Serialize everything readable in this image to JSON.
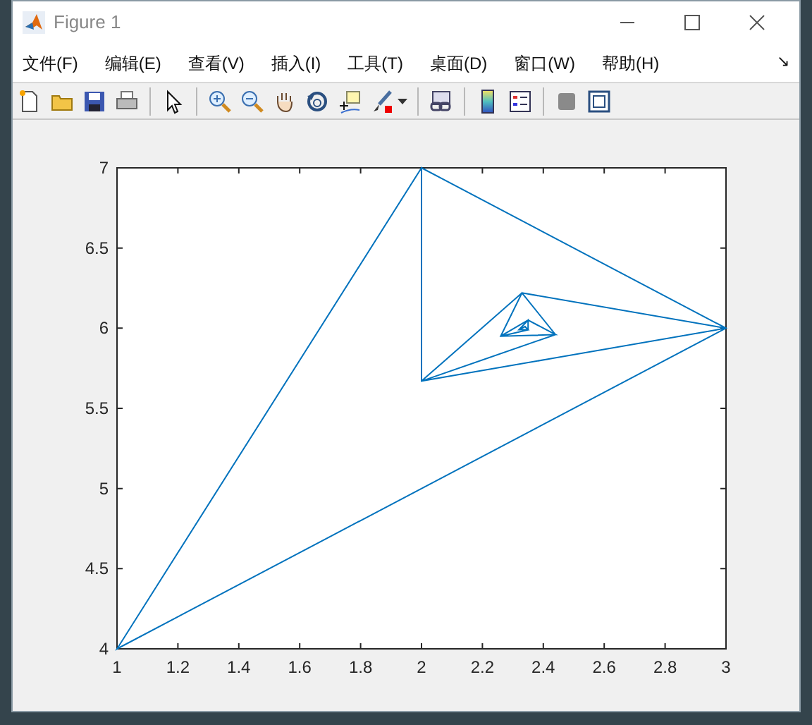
{
  "window": {
    "title": "Figure 1"
  },
  "menu": [
    "文件(F)",
    "编辑(E)",
    "查看(V)",
    "插入(I)",
    "工具(T)",
    "桌面(D)",
    "窗口(W)",
    "帮助(H)"
  ],
  "menu_overflow": "↘",
  "toolbar": [
    {
      "kind": "new"
    },
    {
      "kind": "open"
    },
    {
      "kind": "save"
    },
    {
      "kind": "print"
    },
    {
      "kind": "separator"
    },
    {
      "kind": "pointer"
    },
    {
      "kind": "separator"
    },
    {
      "kind": "zoom-in"
    },
    {
      "kind": "zoom-out"
    },
    {
      "kind": "pan"
    },
    {
      "kind": "rotate"
    },
    {
      "kind": "datatip"
    },
    {
      "kind": "brush"
    },
    {
      "kind": "separator"
    },
    {
      "kind": "link"
    },
    {
      "kind": "separator"
    },
    {
      "kind": "colorbar"
    },
    {
      "kind": "legend"
    },
    {
      "kind": "separator"
    },
    {
      "kind": "hide-tools"
    },
    {
      "kind": "show-tools"
    }
  ],
  "axes": {
    "chart_data": {
      "type": "line",
      "xlim": [
        1,
        3
      ],
      "ylim": [
        4,
        7
      ],
      "xticks": [
        {
          "value": 1,
          "label": "1"
        },
        {
          "value": 1.2,
          "label": "1.2"
        },
        {
          "value": 1.4,
          "label": "1.4"
        },
        {
          "value": 1.6,
          "label": "1.6"
        },
        {
          "value": 1.8,
          "label": "1.8"
        },
        {
          "value": 2,
          "label": "2"
        },
        {
          "value": 2.2,
          "label": "2.2"
        },
        {
          "value": 2.4,
          "label": "2.4"
        },
        {
          "value": 2.6,
          "label": "2.6"
        },
        {
          "value": 2.8,
          "label": "2.8"
        },
        {
          "value": 3,
          "label": "3"
        }
      ],
      "yticks": [
        {
          "value": 4,
          "label": "4"
        },
        {
          "value": 4.5,
          "label": "4.5"
        },
        {
          "value": 5,
          "label": "5"
        },
        {
          "value": 5.5,
          "label": "5.5"
        },
        {
          "value": 6,
          "label": "6"
        },
        {
          "value": 6.5,
          "label": "6.5"
        },
        {
          "value": 7,
          "label": "7"
        }
      ],
      "x": [
        2,
        1,
        3,
        2,
        2,
        3,
        2.33,
        2,
        2.44,
        2.33,
        2.26,
        2.44,
        2.35,
        2.26,
        2.35,
        2.35,
        2.32,
        2.35,
        2.34,
        2.32
      ],
      "series": [
        {
          "color": "#0072bd",
          "values": [
            7,
            4,
            6,
            7,
            5.67,
            6,
            6.22,
            5.67,
            5.96,
            6.22,
            5.95,
            5.96,
            6.05,
            5.95,
            5.99,
            6.05,
            5.99,
            5.99,
            6.01,
            5.99
          ]
        }
      ]
    }
  }
}
